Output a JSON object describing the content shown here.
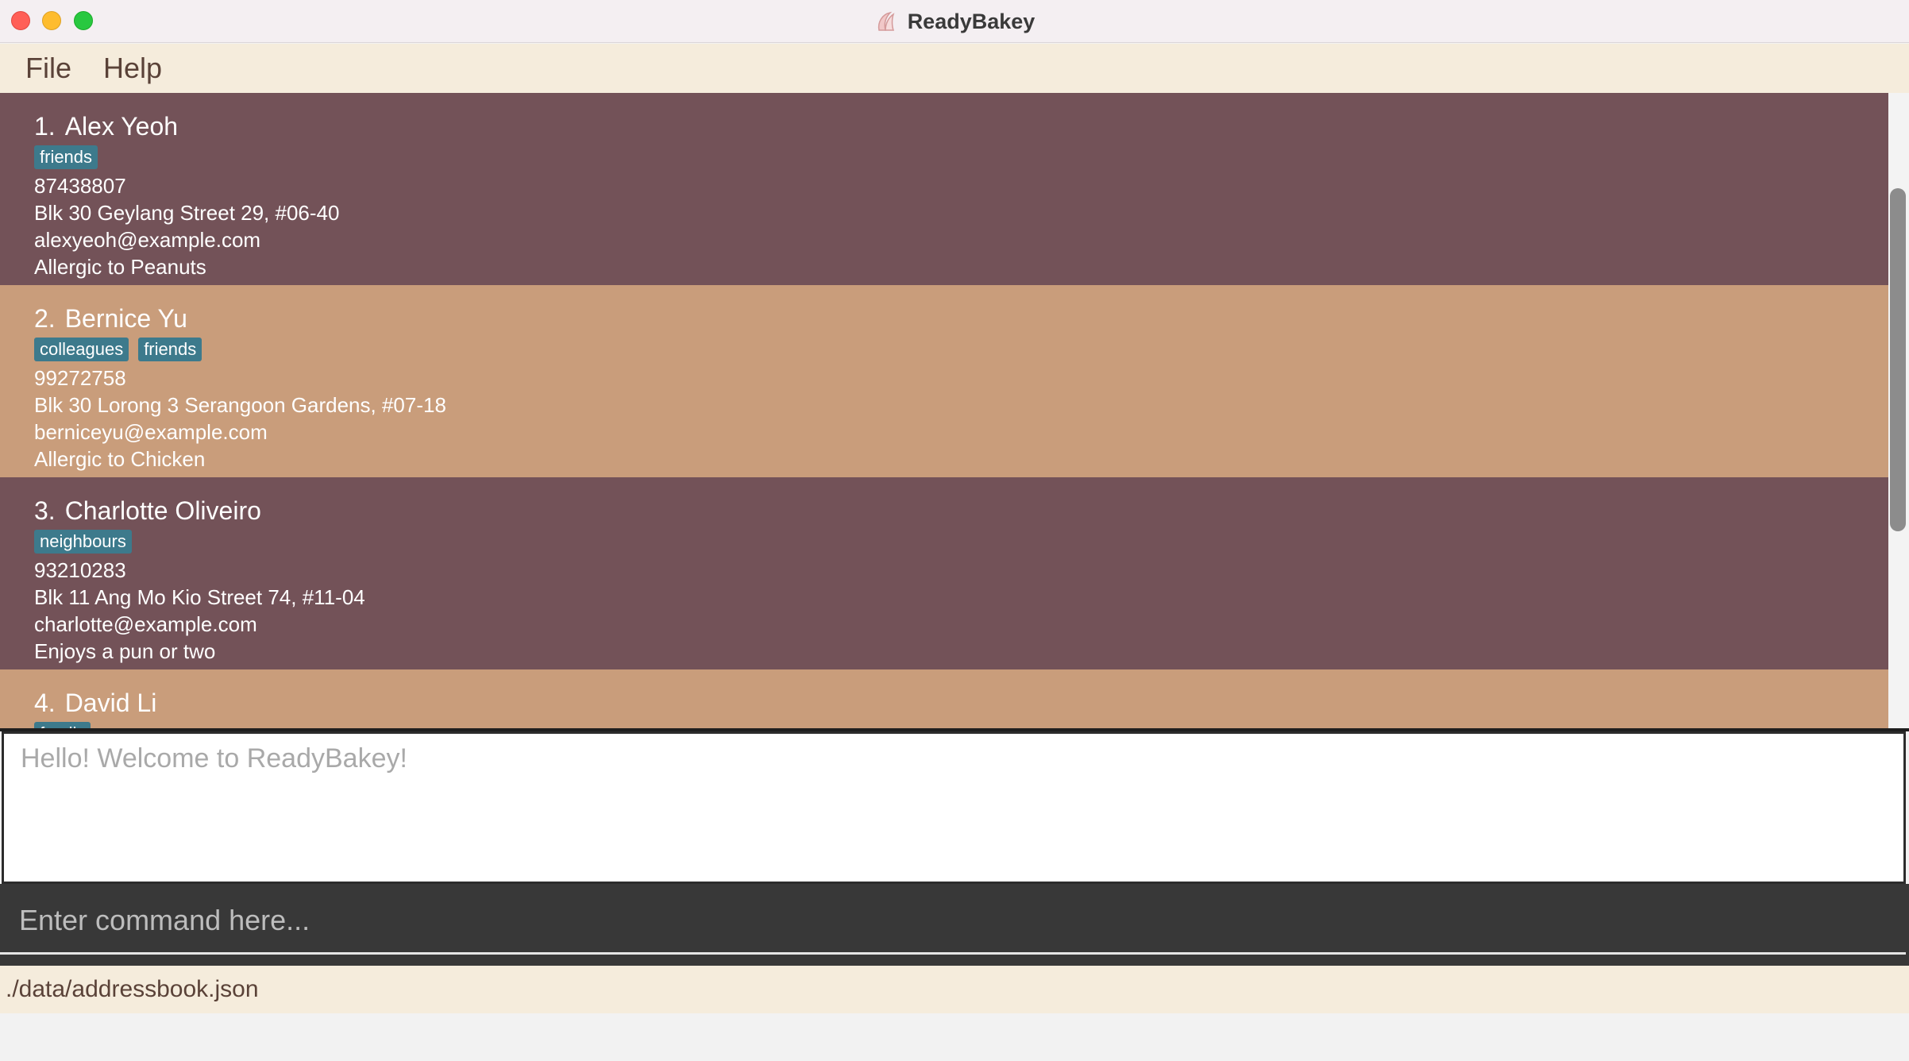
{
  "window": {
    "title": "ReadyBakey"
  },
  "menu": {
    "items": [
      "File",
      "Help"
    ]
  },
  "persons": [
    {
      "index": "1.",
      "name": "Alex Yeoh",
      "tags": [
        "friends"
      ],
      "phone": "87438807",
      "address": "Blk 30 Geylang Street 29, #06-40",
      "email": "alexyeoh@example.com",
      "note": "Allergic to Peanuts"
    },
    {
      "index": "2.",
      "name": "Bernice Yu",
      "tags": [
        "colleagues",
        "friends"
      ],
      "phone": "99272758",
      "address": "Blk 30 Lorong 3 Serangoon Gardens, #07-18",
      "email": "berniceyu@example.com",
      "note": "Allergic to Chicken"
    },
    {
      "index": "3.",
      "name": "Charlotte Oliveiro",
      "tags": [
        "neighbours"
      ],
      "phone": "93210283",
      "address": "Blk 11 Ang Mo Kio Street 74, #11-04",
      "email": "charlotte@example.com",
      "note": "Enjoys a pun or two"
    },
    {
      "index": "4.",
      "name": "David Li",
      "tags": [
        "family"
      ],
      "phone": "",
      "address": "",
      "email": "",
      "note": ""
    }
  ],
  "result_display": {
    "text": "Hello! Welcome to ReadyBakey!"
  },
  "command_box": {
    "placeholder": "Enter command here..."
  },
  "status_bar": {
    "file_path": "./data/addressbook.json"
  },
  "colors": {
    "card_dark": "#735258",
    "card_light": "#c99d7b",
    "tag": "#3d7a8c",
    "menu_bg": "#f5ecdc"
  }
}
